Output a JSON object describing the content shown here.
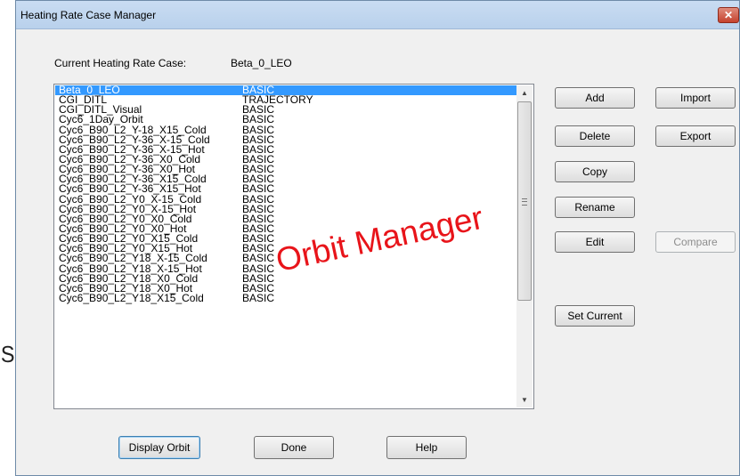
{
  "side_fragment": "S",
  "window": {
    "title": "Heating Rate Case Manager",
    "close_label": "✕"
  },
  "current_case": {
    "label": "Current Heating Rate Case:",
    "value": "Beta_0_LEO"
  },
  "cases": [
    {
      "name": "Beta_0_LEO",
      "type": "BASIC",
      "selected": true
    },
    {
      "name": "CGI_DITL",
      "type": "TRAJECTORY"
    },
    {
      "name": "CGI_DITL_Visual",
      "type": "BASIC"
    },
    {
      "name": "Cyc6_1Day_Orbit",
      "type": "BASIC"
    },
    {
      "name": "Cyc6_B90_L2_Y-18_X15_Cold",
      "type": "BASIC"
    },
    {
      "name": "Cyc6_B90_L2_Y-36_X-15_Cold",
      "type": "BASIC"
    },
    {
      "name": "Cyc6_B90_L2_Y-36_X-15_Hot",
      "type": "BASIC"
    },
    {
      "name": "Cyc6_B90_L2_Y-36_X0_Cold",
      "type": "BASIC"
    },
    {
      "name": "Cyc6_B90_L2_Y-36_X0_Hot",
      "type": "BASIC"
    },
    {
      "name": "Cyc6_B90_L2_Y-36_X15_Cold",
      "type": "BASIC"
    },
    {
      "name": "Cyc6_B90_L2_Y-36_X15_Hot",
      "type": "BASIC"
    },
    {
      "name": "Cyc6_B90_L2_Y0_X-15_Cold",
      "type": "BASIC"
    },
    {
      "name": "Cyc6_B90_L2_Y0_X-15_Hot",
      "type": "BASIC"
    },
    {
      "name": "Cyc6_B90_L2_Y0_X0_Cold",
      "type": "BASIC"
    },
    {
      "name": "Cyc6_B90_L2_Y0_X0_Hot",
      "type": "BASIC"
    },
    {
      "name": "Cyc6_B90_L2_Y0_X15_Cold",
      "type": "BASIC"
    },
    {
      "name": "Cyc6_B90_L2_Y0_X15_Hot",
      "type": "BASIC"
    },
    {
      "name": "Cyc6_B90_L2_Y18_X-15_Cold",
      "type": "BASIC"
    },
    {
      "name": "Cyc6_B90_L2_Y18_X-15_Hot",
      "type": "BASIC"
    },
    {
      "name": "Cyc6_B90_L2_Y18_X0_Cold",
      "type": "BASIC"
    },
    {
      "name": "Cyc6_B90_L2_Y18_X0_Hot",
      "type": "BASIC"
    },
    {
      "name": "Cyc6_B90_L2_Y18_X15_Cold",
      "type": "BASIC"
    }
  ],
  "scroll": {
    "up_arrow": "▲",
    "down_arrow": "▼"
  },
  "buttons": {
    "add": "Add",
    "import": "Import",
    "delete": "Delete",
    "export": "Export",
    "copy": "Copy",
    "rename": "Rename",
    "edit": "Edit",
    "compare": "Compare",
    "set_current": "Set Current",
    "display_orbit": "Display Orbit",
    "done": "Done",
    "help": "Help"
  },
  "overlay_text": "Orbit Manager"
}
